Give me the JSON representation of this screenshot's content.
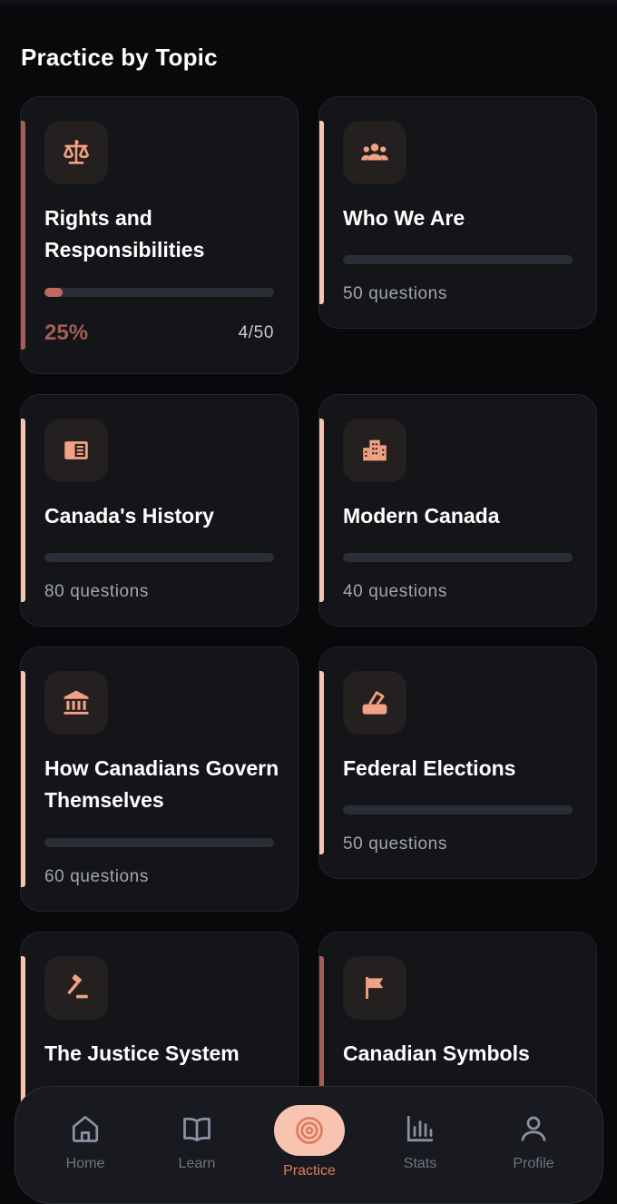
{
  "section_title": "Practice by Topic",
  "colors": {
    "accent_peach": "#f6c4b1",
    "accent_rust": "#a45e57",
    "icon_orange": "#f3a184",
    "card_bg": "#131519"
  },
  "topics": [
    {
      "title": "Rights and Responsibilities",
      "icon": "scales-icon",
      "progress_percent": "25%",
      "progress_fraction": 0.08,
      "progress_count": "4/50"
    },
    {
      "title": "Who We Are",
      "icon": "people-group-icon",
      "questions": "50 questions"
    },
    {
      "title": "Canada's History",
      "icon": "book-icon",
      "questions": "80 questions"
    },
    {
      "title": "Modern Canada",
      "icon": "city-buildings-icon",
      "questions": "40 questions"
    },
    {
      "title": "How Canadians Govern Themselves",
      "icon": "government-building-icon",
      "questions": "60 questions"
    },
    {
      "title": "Federal Elections",
      "icon": "ballot-box-icon",
      "questions": "50 questions"
    },
    {
      "title": "The Justice System",
      "icon": "gavel-icon"
    },
    {
      "title": "Canadian Symbols",
      "icon": "flag-icon"
    }
  ],
  "nav": {
    "items": [
      {
        "label": "Home",
        "icon": "home-icon"
      },
      {
        "label": "Learn",
        "icon": "open-book-icon"
      },
      {
        "label": "Practice",
        "icon": "target-icon",
        "active": true
      },
      {
        "label": "Stats",
        "icon": "bar-chart-icon"
      },
      {
        "label": "Profile",
        "icon": "user-icon"
      }
    ]
  }
}
